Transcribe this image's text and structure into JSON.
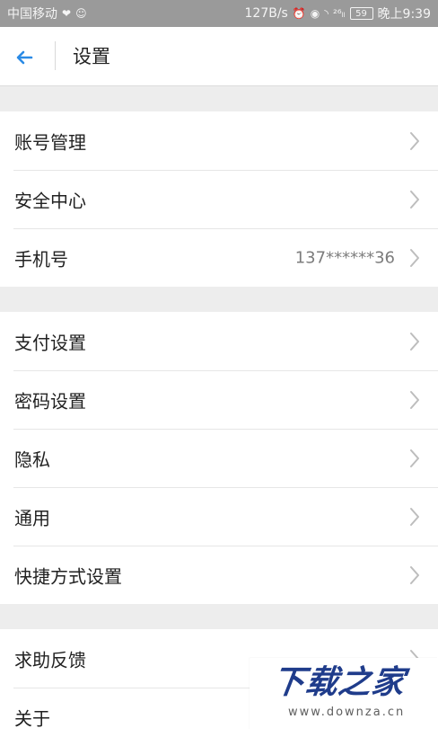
{
  "status_bar": {
    "carrier": "中国移动",
    "speed": "127B/s",
    "signal_label": "²⁶ₗₗ",
    "battery": "59",
    "time": "晚上9:39"
  },
  "header": {
    "title": "设置"
  },
  "sections": [
    {
      "items": [
        {
          "label": "账号管理"
        },
        {
          "label": "安全中心"
        },
        {
          "label": "手机号",
          "value": "137******36"
        }
      ]
    },
    {
      "items": [
        {
          "label": "支付设置"
        },
        {
          "label": "密码设置"
        },
        {
          "label": "隐私"
        },
        {
          "label": "通用"
        },
        {
          "label": "快捷方式设置"
        }
      ]
    },
    {
      "items": [
        {
          "label": "求助反馈"
        },
        {
          "label": "关于"
        }
      ]
    }
  ],
  "watermark": {
    "main": "下载之家",
    "sub": "www.downza.cn"
  },
  "colors": {
    "accent": "#2b8be6",
    "status_bar": "#9a9a9a",
    "background": "#ededed",
    "text": "#222222",
    "muted": "#7c7c7c",
    "chevron": "#bdbdbd",
    "watermark": "#1f3c8b"
  },
  "icons": {
    "back": "arrow-left-icon",
    "chevron": "chevron-right-icon",
    "heart": "heart-icon",
    "smile": "smile-icon",
    "alarm": "alarm-icon",
    "eye": "eye-icon",
    "wifi": "wifi-icon",
    "battery": "battery-icon"
  }
}
